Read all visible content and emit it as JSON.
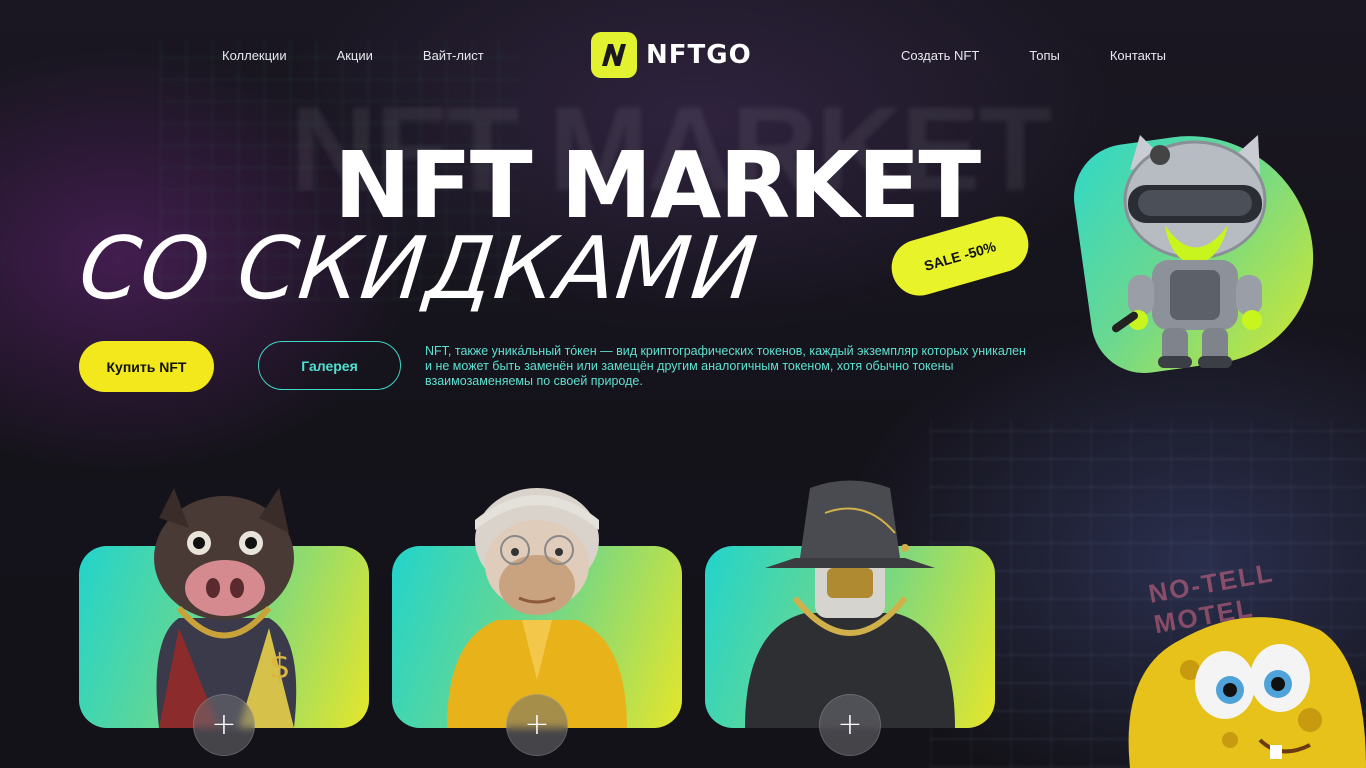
{
  "nav": {
    "left": [
      "Коллекции",
      "Акции",
      "Вайт-лист"
    ],
    "right": [
      "Создать NFT",
      "Топы",
      "Контакты"
    ],
    "logo_text": "NFTGO"
  },
  "hero": {
    "title_line1": "NFT MARKET",
    "title_line2": "СО СКИДКАМИ",
    "sale_badge": "SALE -50%",
    "buy_button": "Купить NFT",
    "gallery_button": "Галерея",
    "description": "NFT, также уника́льный то́кен — вид криптографических токенов, каждый экземпляр которых уникален и не может быть заменён или замещён другим аналогичным токеном, хотя обычно токены взаимозаменяемы по своей природе."
  },
  "background": {
    "sign": "NO-TELL MOTEL"
  },
  "cards": [
    {
      "name": "boar-character",
      "plus": "+"
    },
    {
      "name": "ape-character",
      "plus": "+"
    },
    {
      "name": "masked-character",
      "plus": "+"
    }
  ],
  "colors": {
    "accent_yellow": "#f2e81c",
    "accent_teal": "#3fd8c6",
    "background": "#15131b"
  },
  "icons": {
    "logo": "n-letter-icon",
    "card_action": "plus-icon"
  }
}
